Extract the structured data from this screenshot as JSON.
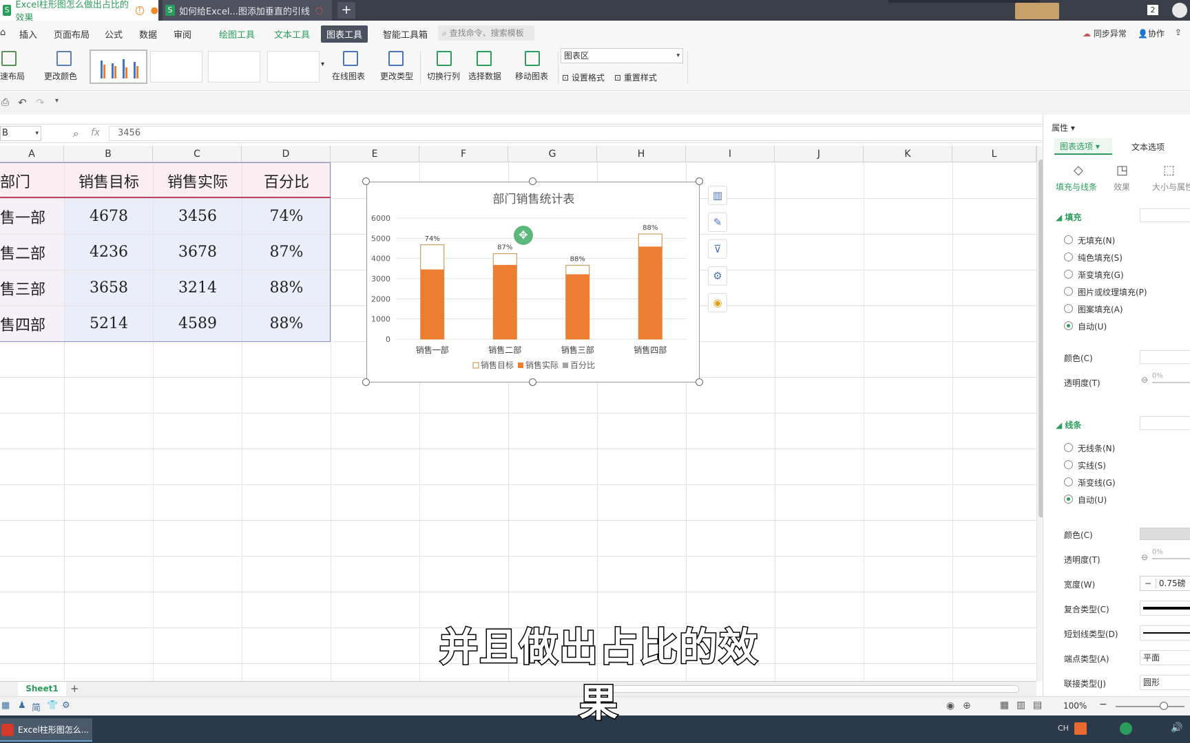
{
  "tabs": [
    {
      "label": "Excel柱形图怎么做出占比的效果",
      "badge": "!"
    },
    {
      "label": "如何给Excel...图添加垂直的引线"
    }
  ],
  "tabbar": {
    "new_tab": "+",
    "count": "2"
  },
  "menu": {
    "items": [
      "插入",
      "页面布局",
      "公式",
      "数据",
      "审阅",
      "绘图工具",
      "文本工具",
      "图表工具",
      "智能工具箱"
    ],
    "search_placeholder": "查找命令、搜索模板",
    "sync": "同步异常",
    "collab": "协作"
  },
  "ribbon": {
    "layout": "速布局",
    "change_color": "更改颜色",
    "online_chart": "在线图表",
    "change_type": "更改类型",
    "switch_rowcol": "切换行列",
    "select_data": "选择数据",
    "move_chart": "移动图表",
    "chart_area": "图表区",
    "set_format": "设置格式",
    "reset_style": "重置样式"
  },
  "formula": {
    "cellref": "B",
    "fx": "fx",
    "value": "3456"
  },
  "columns": [
    "A",
    "B",
    "C",
    "D",
    "E",
    "F",
    "G",
    "H",
    "I",
    "J",
    "K",
    "L"
  ],
  "table": {
    "headers": [
      "部门",
      "销售目标",
      "销售实际",
      "百分比"
    ],
    "rows": [
      [
        "售一部",
        "4678",
        "3456",
        "74%"
      ],
      [
        "售二部",
        "4236",
        "3678",
        "87%"
      ],
      [
        "售三部",
        "3658",
        "3214",
        "88%"
      ],
      [
        "售四部",
        "5214",
        "4589",
        "88%"
      ]
    ]
  },
  "chart_data": {
    "type": "bar",
    "title": "部门销售统计表",
    "categories": [
      "销售一部",
      "销售二部",
      "销售三部",
      "销售四部"
    ],
    "series": [
      {
        "name": "销售目标",
        "values": [
          4678,
          4236,
          3658,
          5214
        ],
        "color": "#ffffff",
        "stroke": "#c08a3e"
      },
      {
        "name": "销售实际",
        "values": [
          3456,
          3678,
          3214,
          4589
        ],
        "color": "#ed7d31"
      },
      {
        "name": "百分比",
        "values": [
          0.74,
          0.87,
          0.88,
          0.88
        ],
        "color": "#a5a5a5"
      }
    ],
    "data_labels": [
      "74%",
      "87%",
      "88%",
      "88%"
    ],
    "yticks": [
      "0",
      "1000",
      "2000",
      "3000",
      "4000",
      "5000",
      "6000"
    ],
    "ylim": [
      0,
      6000
    ],
    "legend": "bottom",
    "grid": true
  },
  "panel": {
    "title": "属性",
    "tab1": "图表选项",
    "tab2": "文本选项",
    "sub1": "填充与线条",
    "sub2": "效果",
    "sub3": "大小与属性",
    "fill_section": "填充",
    "fill_options": [
      "无填充(N)",
      "纯色填充(S)",
      "渐变填充(G)",
      "图片或纹理填充(P)",
      "图案填充(A)",
      "自动(U)"
    ],
    "color": "颜色(C)",
    "transparency": "透明度(T)",
    "pct": "0%",
    "line_section": "线条",
    "line_options": [
      "无线条(N)",
      "实线(S)",
      "渐变线(G)",
      "自动(U)"
    ],
    "width_label": "宽度(W)",
    "width_value": "0.75磅",
    "compound": "复合类型(C)",
    "dash": "短划线类型(D)",
    "cap": "端点类型(A)",
    "cap_value": "平面",
    "join": "联接类型(J)",
    "join_value": "圆形"
  },
  "sheet": {
    "name": "Sheet1",
    "add": "+"
  },
  "status": {
    "simplified": "简",
    "zoom": "100%"
  },
  "taskbar": {
    "app": "Excel柱形图怎么..."
  },
  "subtitle": "并且做出占比的效果"
}
